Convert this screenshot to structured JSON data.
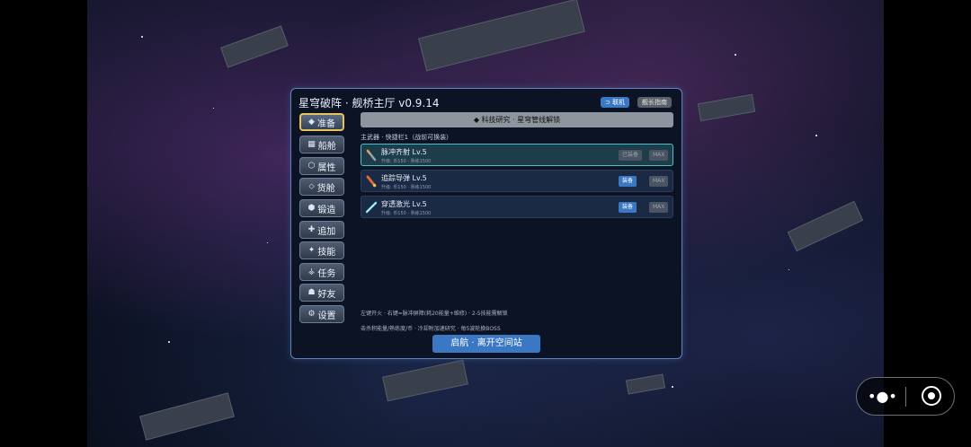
{
  "title": "星穹破阵 · 舰桥主厅 v0.9.14",
  "top_buttons": {
    "link": "⊃ 联机",
    "guide": "舰长指南"
  },
  "sidebar": {
    "items": [
      {
        "label": "准备",
        "icon": "◆",
        "active": true
      },
      {
        "label": "船舱",
        "icon": "▦",
        "active": false
      },
      {
        "label": "属性",
        "icon": "⬡",
        "active": false
      },
      {
        "label": "货舱",
        "icon": "⬦",
        "active": false
      },
      {
        "label": "锻造",
        "icon": "⬢",
        "active": false
      },
      {
        "label": "追加",
        "icon": "✚",
        "active": false
      },
      {
        "label": "技能",
        "icon": "✦",
        "active": false
      },
      {
        "label": "任务",
        "icon": "⚶",
        "active": false
      },
      {
        "label": "好友",
        "icon": "☗",
        "active": false
      },
      {
        "label": "设置",
        "icon": "⚙",
        "active": false
      }
    ]
  },
  "banner": "◆ 科技研究 · 星穹管线解锁",
  "section_label": "主武器 · 快捷栏1（战前可换装）",
  "weapons": [
    {
      "name": "脉冲齐射  Lv.5",
      "sub": "升级: 币150 · 熟练1500",
      "action": "已装备",
      "max": "MAX",
      "equipped": true
    },
    {
      "name": "追踪导弹  Lv.5",
      "sub": "升级: 币150 · 熟练1500",
      "action": "装备",
      "max": "MAX",
      "equipped": false
    },
    {
      "name": "穿透激光  Lv.5",
      "sub": "升级: 币150 · 熟练1500",
      "action": "装备",
      "max": "MAX",
      "equipped": false
    }
  ],
  "hints": [
    "左键开火 · 右键=脉冲屏障(耗20能量+维修) · 2-5技能需解锁",
    "击杀积能量/熟练度/币 · 冷却附加速研究 · 每5波轮换BOSS"
  ],
  "launch_label": "启航 · 离开空间站",
  "capsule": {
    "more": "•●•"
  },
  "colors": {
    "accent": "#3a78c4",
    "selected_border": "#49c1c9",
    "active_border": "#e7c35a"
  }
}
